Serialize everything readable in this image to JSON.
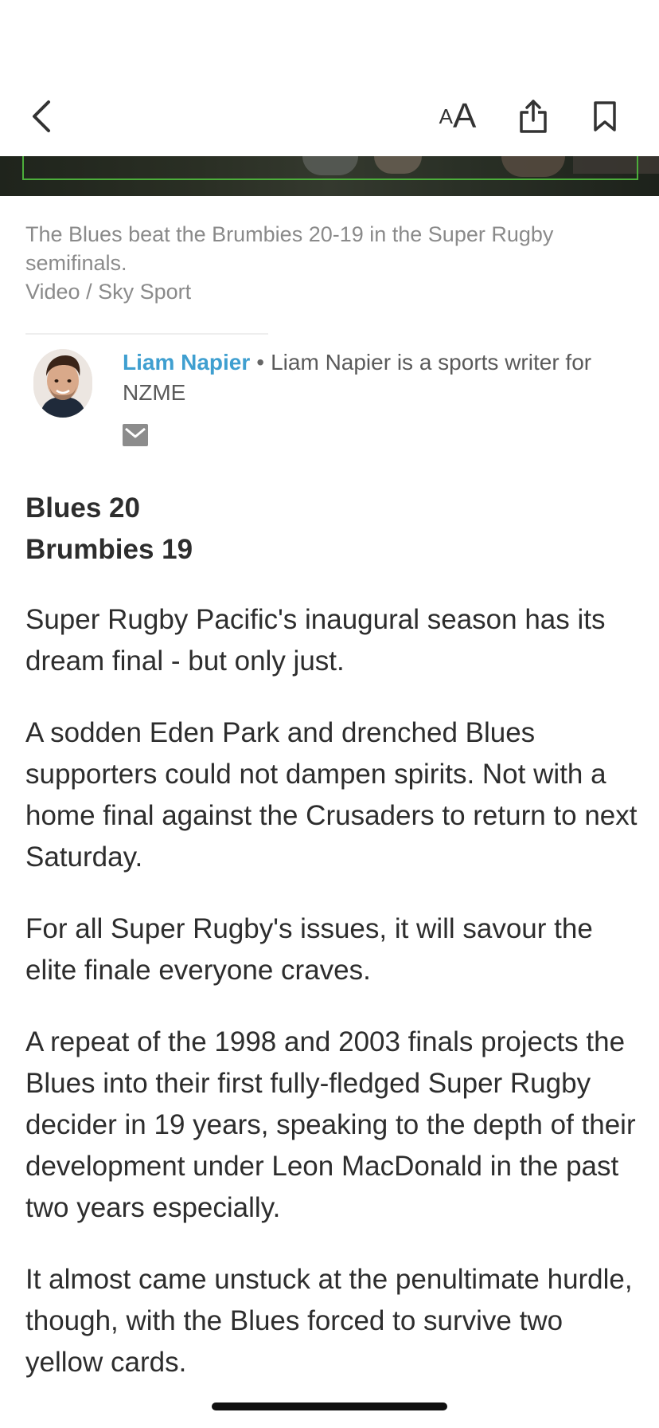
{
  "nav": {
    "back_icon": "chevron-left-icon",
    "text_size_small": "A",
    "text_size_large": "A",
    "share_icon": "share-icon",
    "bookmark_icon": "bookmark-icon"
  },
  "media": {
    "caption": "The Blues beat the Brumbies 20-19 in the Super Rugby semifinals.",
    "credit": "Video / Sky Sport"
  },
  "author": {
    "name": "Liam Napier",
    "separator": "•",
    "bio": "Liam Napier is a sports writer for NZME",
    "mail_icon": "mail-icon"
  },
  "article": {
    "score_line_1": "Blues 20",
    "score_line_2": "Brumbies 19",
    "paragraphs": [
      "Super Rugby Pacific's inaugural season has its dream final - but only just.",
      "A sodden Eden Park and drenched Blues supporters could not dampen spirits. Not with a home final against the Crusaders to return to next Saturday.",
      "For all Super Rugby's issues, it will savour the elite finale everyone craves.",
      "A repeat of the 1998 and 2003 finals projects the Blues into their first fully-fledged Super Rugby decider in 19 years, speaking to the depth of their development under Leon MacDonald in the past two years especially.",
      "It almost came unstuck at the penultimate hurdle, though, with the Blues forced to survive two yellow cards."
    ]
  },
  "colors": {
    "author_link": "#3f9fd0",
    "caption": "#8a8a8a",
    "body_text": "#2d2d2d",
    "video_border": "#4cae3b"
  }
}
